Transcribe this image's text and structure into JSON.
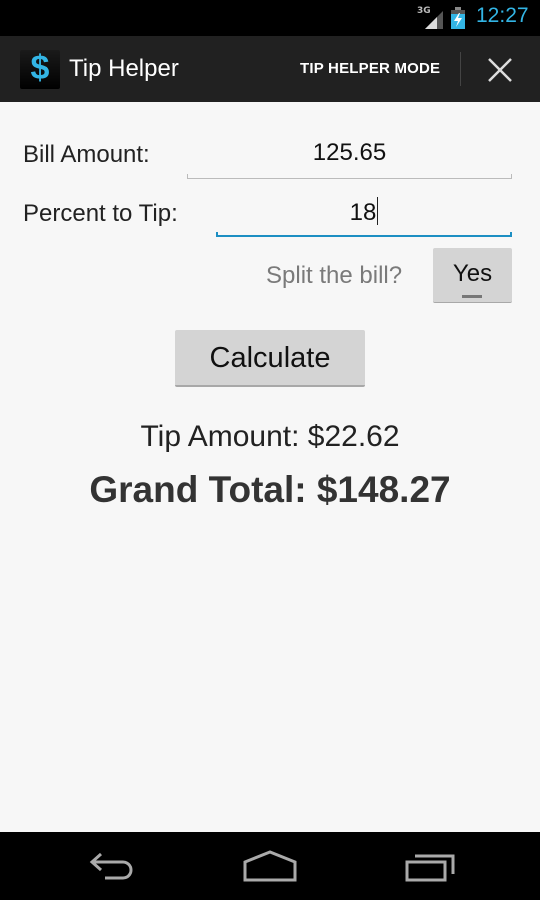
{
  "status_bar": {
    "network": "3G",
    "time": "12:27",
    "colors": {
      "accent": "#33b5e5"
    }
  },
  "action_bar": {
    "app_icon": "dollar-sign-icon",
    "app_icon_glyph": "$",
    "title": "Tip Helper",
    "mode_button": "TIP HELPER MODE",
    "close_icon": "close-icon"
  },
  "form": {
    "bill_amount": {
      "label": "Bill Amount:",
      "value": "125.65"
    },
    "percent_to_tip": {
      "label": "Percent to Tip:",
      "value": "18"
    },
    "split": {
      "label": "Split the bill?",
      "toggle_label": "Yes"
    },
    "calculate_label": "Calculate"
  },
  "results": {
    "tip_amount": "Tip Amount: $22.62",
    "grand_total": "Grand Total: $148.27"
  },
  "nav_bar": {
    "back_icon": "back-icon",
    "home_icon": "home-icon",
    "recents_icon": "recent-apps-icon"
  },
  "colors": {
    "focus_underline": "#1d8fc3",
    "action_bar_bg": "#212121",
    "button_bg": "#d4d4d4"
  }
}
